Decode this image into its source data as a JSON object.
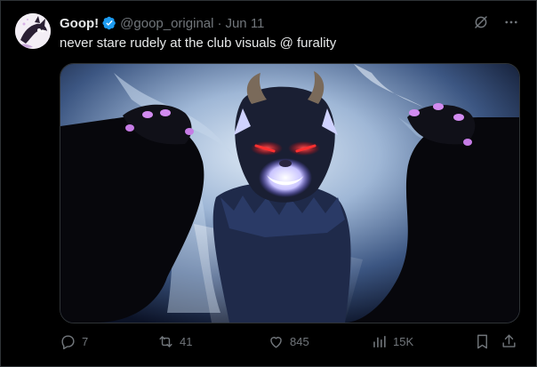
{
  "post": {
    "display_name": "Goop!",
    "handle": "@goop_original",
    "separator": "·",
    "date": "Jun 11",
    "text": "never stare rudely at the club visuals @ furality",
    "verified": true,
    "media_description_icon": "wolf-fursuit-photo"
  },
  "metrics": {
    "replies": "7",
    "reposts": "41",
    "likes": "845",
    "views": "15K"
  },
  "colors": {
    "background": "#000000",
    "text": "#e7e9ea",
    "muted": "#71767b",
    "verified": "#1d9bf0",
    "border": "#2f3336"
  },
  "icons": {
    "verified": "verified-badge-icon",
    "grok": "grok-icon",
    "more": "more-icon",
    "reply": "reply-icon",
    "repost": "repost-icon",
    "like": "like-icon",
    "views": "views-icon",
    "bookmark": "bookmark-icon",
    "share": "share-icon"
  }
}
